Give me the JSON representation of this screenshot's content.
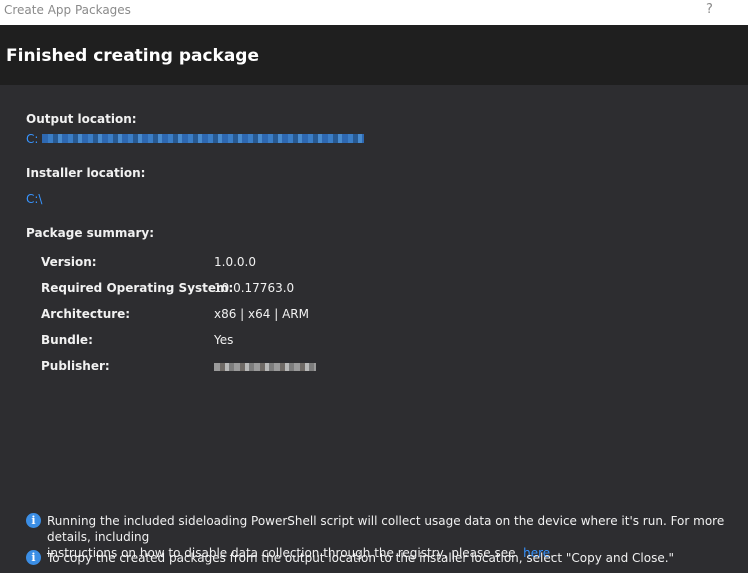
{
  "window": {
    "title": "Create App Packages",
    "help_label": "?"
  },
  "header": {
    "title": "Finished creating package"
  },
  "output": {
    "label": "Output location:",
    "path_prefix": "C:"
  },
  "installer": {
    "label": "Installer location:",
    "path": "C:\\"
  },
  "summary": {
    "label": "Package summary:",
    "rows": [
      {
        "key": "Version:",
        "value": "1.0.0.0"
      },
      {
        "key": "Required Operating System:",
        "value": "10.0.17763.0"
      },
      {
        "key": "Architecture:",
        "value": "x86 | x64 | ARM"
      },
      {
        "key": "Bundle:",
        "value": "Yes"
      },
      {
        "key": "Publisher:",
        "value": ""
      }
    ]
  },
  "notices": {
    "telemetry_line1": "Running the included sideloading PowerShell script will collect usage data on the device where it's run.  For more details, including",
    "telemetry_line2": "instructions on how to disable data collection through the registry, please see",
    "telemetry_link": "here",
    "telemetry_end": ".",
    "copy_text": "To copy the created packages from the output location to the installer location, select \"Copy and Close.\""
  },
  "icons": {
    "info": "info-icon",
    "help": "help-icon"
  },
  "colors": {
    "background": "#2d2d30",
    "header": "#1f1f1f",
    "link": "#3794ff",
    "info_icon": "#3b8ee5"
  }
}
